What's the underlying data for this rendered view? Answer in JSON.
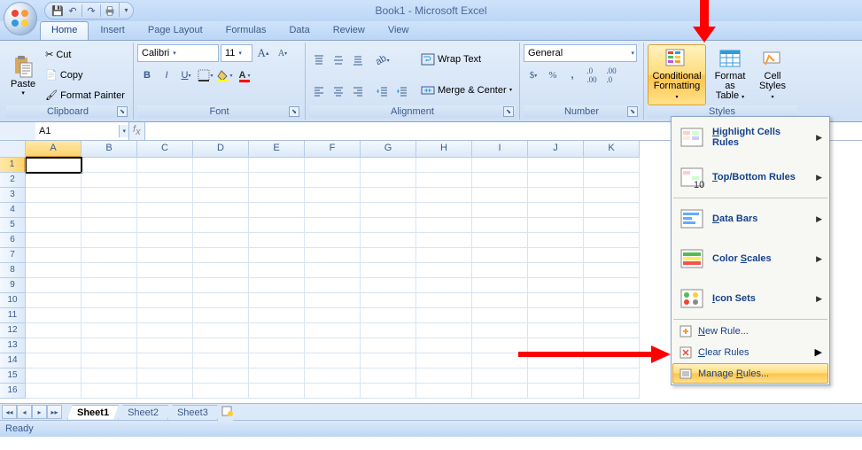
{
  "title": "Book1 - Microsoft Excel",
  "qat": {
    "save": "💾",
    "undo": "↶",
    "redo": "↷",
    "print": "⎙"
  },
  "tabs": [
    "Home",
    "Insert",
    "Page Layout",
    "Formulas",
    "Data",
    "Review",
    "View"
  ],
  "activeTab": "Home",
  "clipboard": {
    "label": "Clipboard",
    "paste": "Paste",
    "cut": "Cut",
    "copy": "Copy",
    "painter": "Format Painter"
  },
  "font": {
    "label": "Font",
    "name": "Calibri",
    "size": "11"
  },
  "alignment": {
    "label": "Alignment",
    "wrap": "Wrap Text",
    "merge": "Merge & Center"
  },
  "number": {
    "label": "Number",
    "format": "General"
  },
  "styles": {
    "label": "Styles",
    "cond": "Conditional",
    "cond2": "Formatting",
    "fmt": "Format",
    "fmt2": "as Table",
    "cell": "Cell",
    "cell2": "Styles"
  },
  "nameBox": "A1",
  "columns": [
    "A",
    "B",
    "C",
    "D",
    "E",
    "F",
    "G",
    "H",
    "I",
    "J",
    "K"
  ],
  "rows": [
    "1",
    "2",
    "3",
    "4",
    "5",
    "6",
    "7",
    "8",
    "9",
    "10",
    "11",
    "12",
    "13",
    "14",
    "15",
    "16"
  ],
  "dropdown": {
    "items": [
      {
        "label": "Highlight Cells Rules",
        "accel": "H"
      },
      {
        "label": "Top/Bottom Rules",
        "accel": "T"
      },
      {
        "label": "Data Bars",
        "accel": "D"
      },
      {
        "label": "Color Scales",
        "accel": "S"
      },
      {
        "label": "Icon Sets",
        "accel": "I"
      }
    ],
    "newRule": "New Rule...",
    "clearRules": "Clear Rules",
    "manageRules": "Manage Rules..."
  },
  "sheets": [
    "Sheet1",
    "Sheet2",
    "Sheet3"
  ],
  "status": "Ready"
}
